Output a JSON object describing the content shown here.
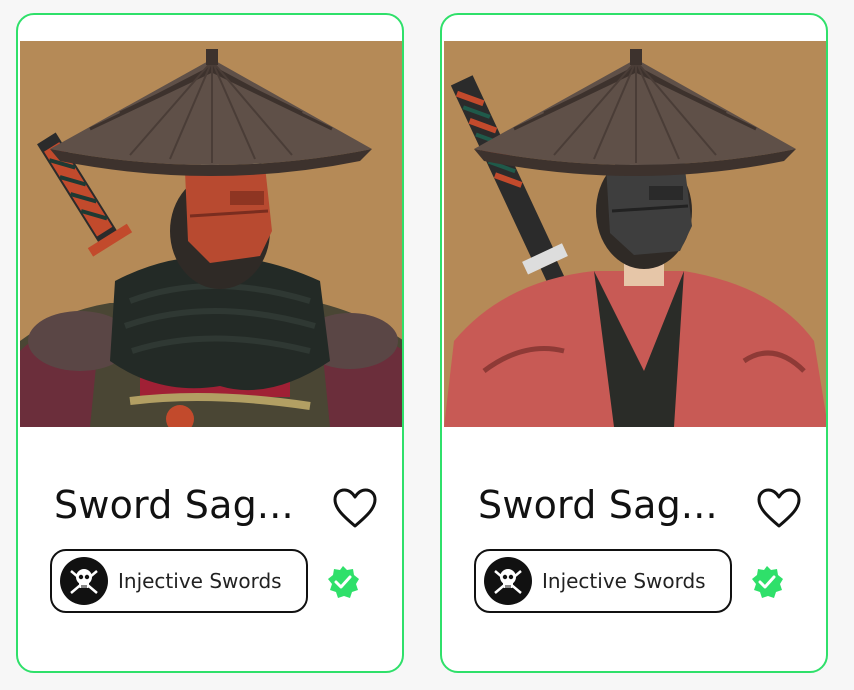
{
  "cards": [
    {
      "title": "Sword Sag...",
      "collection": "Injective Swords",
      "image": "samurai-red-mask",
      "favorite_icon": "heart-outline-icon",
      "verified_icon": "verified-badge-icon"
    },
    {
      "title": "Sword Sag...",
      "collection": "Injective Swords",
      "image": "samurai-black-mask",
      "favorite_icon": "heart-outline-icon",
      "verified_icon": "verified-badge-icon"
    }
  ],
  "colors": {
    "card_border": "#2fe06a",
    "verified": "#2fe06a",
    "art_background": "#b58a57",
    "text": "#111111"
  }
}
